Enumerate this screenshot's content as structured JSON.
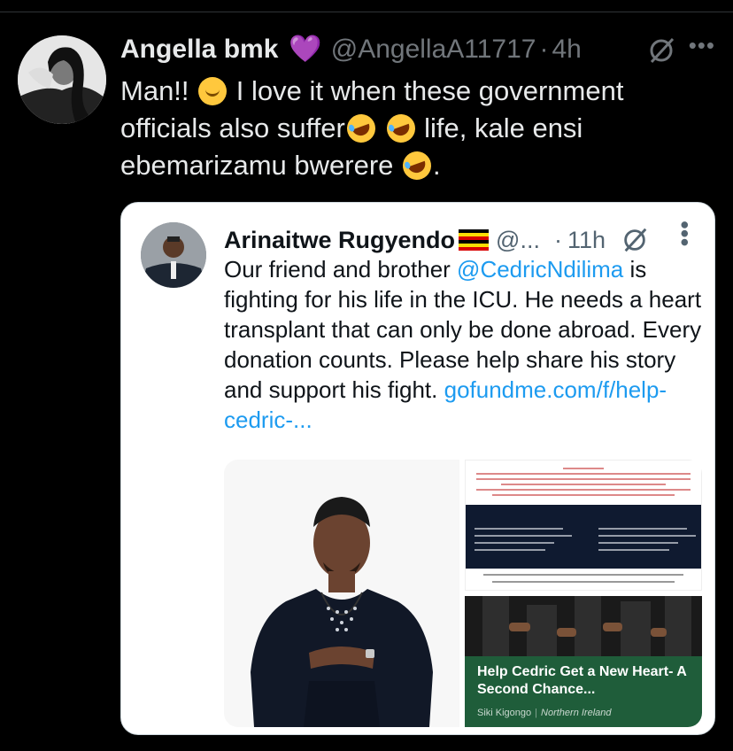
{
  "tweet": {
    "author_name": "Angella bmk",
    "author_handle": "@AngellaA11717",
    "separator": "·",
    "time": "4h",
    "text_part1": "Man!! ",
    "text_part2": " I love it when these government officials also suffer",
    "text_part3": " life, kale ensi ebemarizamu bwerere ",
    "text_part4": ".",
    "emojis": [
      "face-palm-icon",
      "rolling-on-floor-laughing-icon"
    ]
  },
  "quoted_tweet": {
    "author_name": "Arinaitwe Rugyendo",
    "flag": "uganda-flag-icon",
    "author_handle": "@...",
    "separator": "·",
    "time": "11h",
    "text_part1": "Our friend and brother ",
    "mention": "@CedricNdilima",
    "text_part2": " is fighting for his life in the ICU. He needs a heart transplant that can only be done abroad. Every donation counts. Please help share his story and support his fight. ",
    "link": "gofundme.com/f/help-cedric-...",
    "media": {
      "fundraiser_title": "Help Cedric Get a New Heart- A Second Chance...",
      "organizer": "Siki Kigongo",
      "location": "Northern Ireland"
    }
  },
  "colors": {
    "background": "#000000",
    "link": "#1d9bf0",
    "muted": "#71767b",
    "heart": "#9b5de5"
  }
}
